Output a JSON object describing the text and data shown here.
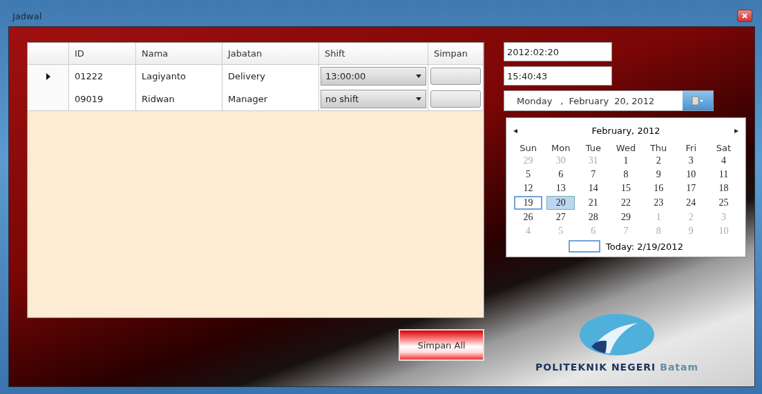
{
  "window": {
    "title": "Jadwal"
  },
  "table": {
    "columns": [
      "ID",
      "Nama",
      "Jabatan",
      "Shift",
      "Simpan"
    ],
    "rows": [
      {
        "current": true,
        "id": "01222",
        "nama": "Lagiyanto",
        "jabatan": "Delivery",
        "shift": "13:00:00"
      },
      {
        "current": false,
        "id": "09019",
        "nama": "Ridwan",
        "jabatan": "Manager",
        "shift": "no shift"
      }
    ]
  },
  "save_all_button": "Simpan All",
  "date_field": {
    "value": "2012:02:20"
  },
  "time_field": {
    "value": "15:40:43"
  },
  "date_picker": {
    "weekday": "Monday",
    "separator": ",",
    "month_day": "February  20, 2012"
  },
  "calendar": {
    "prev": "◂",
    "title": "February, 2012",
    "next": "▸",
    "weekdays": [
      "Sun",
      "Mon",
      "Tue",
      "Wed",
      "Thu",
      "Fri",
      "Sat"
    ],
    "weeks": [
      [
        {
          "d": "29",
          "muted": true,
          "selected": false,
          "today": false
        },
        {
          "d": "30",
          "muted": true,
          "selected": false,
          "today": false
        },
        {
          "d": "31",
          "muted": true,
          "selected": false,
          "today": false
        },
        {
          "d": "1",
          "muted": false,
          "selected": false,
          "today": false
        },
        {
          "d": "2",
          "muted": false,
          "selected": false,
          "today": false
        },
        {
          "d": "3",
          "muted": false,
          "selected": false,
          "today": false
        },
        {
          "d": "4",
          "muted": false,
          "selected": false,
          "today": false
        }
      ],
      [
        {
          "d": "5",
          "muted": false,
          "selected": false,
          "today": false
        },
        {
          "d": "6",
          "muted": false,
          "selected": false,
          "today": false
        },
        {
          "d": "7",
          "muted": false,
          "selected": false,
          "today": false
        },
        {
          "d": "8",
          "muted": false,
          "selected": false,
          "today": false
        },
        {
          "d": "9",
          "muted": false,
          "selected": false,
          "today": false
        },
        {
          "d": "10",
          "muted": false,
          "selected": false,
          "today": false
        },
        {
          "d": "11",
          "muted": false,
          "selected": false,
          "today": false
        }
      ],
      [
        {
          "d": "12",
          "muted": false,
          "selected": false,
          "today": false
        },
        {
          "d": "13",
          "muted": false,
          "selected": false,
          "today": false
        },
        {
          "d": "14",
          "muted": false,
          "selected": false,
          "today": false
        },
        {
          "d": "15",
          "muted": false,
          "selected": false,
          "today": false
        },
        {
          "d": "16",
          "muted": false,
          "selected": false,
          "today": false
        },
        {
          "d": "17",
          "muted": false,
          "selected": false,
          "today": false
        },
        {
          "d": "18",
          "muted": false,
          "selected": false,
          "today": false
        }
      ],
      [
        {
          "d": "19",
          "muted": false,
          "selected": false,
          "today": true
        },
        {
          "d": "20",
          "muted": false,
          "selected": true,
          "today": false
        },
        {
          "d": "21",
          "muted": false,
          "selected": false,
          "today": false
        },
        {
          "d": "22",
          "muted": false,
          "selected": false,
          "today": false
        },
        {
          "d": "23",
          "muted": false,
          "selected": false,
          "today": false
        },
        {
          "d": "24",
          "muted": false,
          "selected": false,
          "today": false
        },
        {
          "d": "25",
          "muted": false,
          "selected": false,
          "today": false
        }
      ],
      [
        {
          "d": "26",
          "muted": false,
          "selected": false,
          "today": false
        },
        {
          "d": "27",
          "muted": false,
          "selected": false,
          "today": false
        },
        {
          "d": "28",
          "muted": false,
          "selected": false,
          "today": false
        },
        {
          "d": "29",
          "muted": false,
          "selected": false,
          "today": false
        },
        {
          "d": "1",
          "muted": true,
          "selected": false,
          "today": false
        },
        {
          "d": "2",
          "muted": true,
          "selected": false,
          "today": false
        },
        {
          "d": "3",
          "muted": true,
          "selected": false,
          "today": false
        }
      ],
      [
        {
          "d": "4",
          "muted": true,
          "selected": false,
          "today": false
        },
        {
          "d": "5",
          "muted": true,
          "selected": false,
          "today": false
        },
        {
          "d": "6",
          "muted": true,
          "selected": false,
          "today": false
        },
        {
          "d": "7",
          "muted": true,
          "selected": false,
          "today": false
        },
        {
          "d": "8",
          "muted": true,
          "selected": false,
          "today": false
        },
        {
          "d": "9",
          "muted": true,
          "selected": false,
          "today": false
        },
        {
          "d": "10",
          "muted": true,
          "selected": false,
          "today": false
        }
      ]
    ],
    "today_label": "Today: 2/19/2012"
  },
  "logo": {
    "name": "POLITEKNIK NEGERI",
    "city": "Batam"
  }
}
